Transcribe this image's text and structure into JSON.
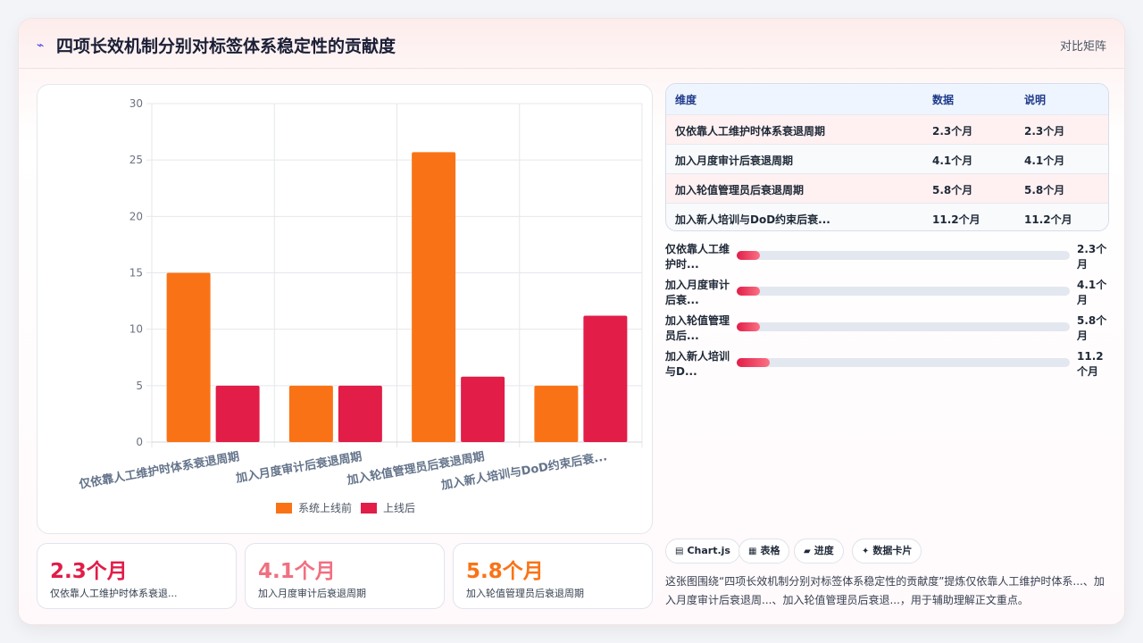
{
  "header": {
    "icon": "chart-spark-icon",
    "title": "四项长效机制分别对标签体系稳定性的贡献度",
    "right_label": "对比矩阵"
  },
  "colors": {
    "series_before": "#f97316",
    "series_after": "#e11d48",
    "accent": "#e11d48"
  },
  "chart_data": {
    "type": "bar",
    "categories": [
      "仅依靠人工维护时体系衰退周期",
      "加入月度审计后衰退周期",
      "加入轮值管理员后衰退周期",
      "加入新人培训与DoD约束后衰..."
    ],
    "series": [
      {
        "name": "系统上线前",
        "values": [
          15,
          5,
          25.7,
          5
        ]
      },
      {
        "name": "上线后",
        "values": [
          5,
          5,
          5.8,
          11.2
        ]
      }
    ],
    "ylim": [
      0,
      30
    ],
    "yticks": [
      0,
      5,
      10,
      15,
      20,
      25,
      30
    ],
    "legend": "bottom",
    "grid": true
  },
  "table": {
    "headers": [
      "维度",
      "数据",
      "说明"
    ],
    "rows": [
      [
        "仅依靠人工维护时体系衰退周期",
        "2.3个月",
        "2.3个月"
      ],
      [
        "加入月度审计后衰退周期",
        "4.1个月",
        "4.1个月"
      ],
      [
        "加入轮值管理员后衰退周期",
        "5.8个月",
        "5.8个月"
      ],
      [
        "加入新人培训与DoD约束后衰...",
        "11.2个月",
        "11.2个月"
      ]
    ]
  },
  "progress": [
    {
      "label": "仅依靠人工维护时...",
      "value": "2.3个月",
      "fraction": 0.07
    },
    {
      "label": "加入月度审计后衰...",
      "value": "4.1个月",
      "fraction": 0.07
    },
    {
      "label": "加入轮值管理员后...",
      "value": "5.8个月",
      "fraction": 0.07
    },
    {
      "label": "加入新人培训与D...",
      "value": "11.2个月",
      "fraction": 0.1
    }
  ],
  "stats": [
    {
      "value": "2.3个月",
      "label": "仅依靠人工维护时体系衰退...",
      "color": "#e11d48"
    },
    {
      "value": "4.1个月",
      "label": "加入月度审计后衰退周期",
      "color": "#f07080"
    },
    {
      "value": "5.8个月",
      "label": "加入轮值管理员后衰退周期",
      "color": "#f97316"
    }
  ],
  "tags": [
    {
      "icon": "chart-icon",
      "glyph": "▤",
      "label": "Chart.js"
    },
    {
      "icon": "table-icon",
      "glyph": "▦",
      "label": "表格"
    },
    {
      "icon": "progress-icon",
      "glyph": "▰",
      "label": "进度"
    },
    {
      "icon": "sparkle-icon",
      "glyph": "✦",
      "label": "数据卡片"
    }
  ],
  "description": "这张图围绕“四项长效机制分别对标签体系稳定性的贡献度”提炼仅依靠人工维护时体系...、加入月度审计后衰退周...、加入轮值管理员后衰退...，用于辅助理解正文重点。"
}
